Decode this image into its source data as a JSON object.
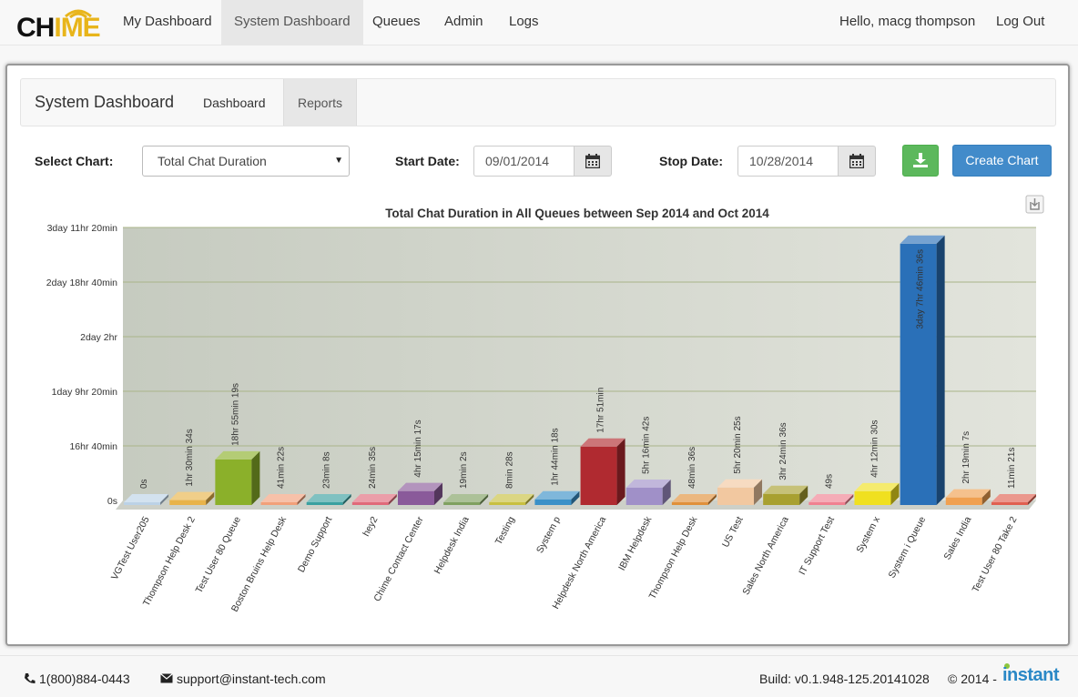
{
  "nav": {
    "logo_a": "CH",
    "logo_b": "ME",
    "logo_i": "I",
    "items": [
      {
        "label": "My Dashboard"
      },
      {
        "label": "System Dashboard"
      },
      {
        "label": "Queues"
      },
      {
        "label": "Admin"
      },
      {
        "label": "Logs"
      }
    ],
    "active": "System Dashboard",
    "user_greeting": "Hello, macg thompson",
    "logout": "Log Out"
  },
  "subnav": {
    "brand": "System Dashboard",
    "tabs": [
      {
        "label": "Dashboard"
      },
      {
        "label": "Reports"
      }
    ],
    "active": "Reports"
  },
  "form": {
    "select_label": "Select Chart:",
    "select_value": "Total Chat Duration",
    "start_label": "Start Date:",
    "start_value": "09/01/2014",
    "stop_label": "Stop Date:",
    "stop_value": "10/28/2014",
    "create_label": "Create Chart"
  },
  "chart_data": {
    "type": "bar",
    "title": "Total Chat Duration in All Queues between Sep 2014 and Oct 2014",
    "xlabel": "",
    "ylabel": "",
    "ylim": [
      0,
      300000
    ],
    "yticks": [
      {
        "value": 0,
        "label": "0s"
      },
      {
        "value": 60000,
        "label": "16hr 40min"
      },
      {
        "value": 120000,
        "label": "1day 9hr 20min"
      },
      {
        "value": 180000,
        "label": "2day 2hr"
      },
      {
        "value": 240000,
        "label": "2day 18hr 40min"
      },
      {
        "value": 300000,
        "label": "3day 11hr 20min"
      }
    ],
    "grid": true,
    "categories": [
      "VGTest User205",
      "Thompson Help Desk 2",
      "Test User 80 Queue",
      "Boston Bruins Help Desk",
      "Demo Support",
      "hey2",
      "Chime Contact Center",
      "Helpdesk India",
      "Testing",
      "System p",
      "Helpdesk North America",
      "IBM Helpdesk",
      "Thompson Help Desk",
      "US Test",
      "Sales North America",
      "IT Support Test",
      "System x",
      "System i Queue",
      "Sales India",
      "Test User 80 Take 2"
    ],
    "values": [
      0,
      5434,
      50119,
      2482,
      1388,
      1475,
      15317,
      1142,
      508,
      6258,
      64260,
      19002,
      2916,
      19225,
      12276,
      49,
      15150,
      287196,
      8347,
      681
    ],
    "data_labels": [
      "0s",
      "1hr 30min 34s",
      "18hr 55min 19s",
      "41min 22s",
      "23min 8s",
      "24min 35s",
      "4hr 15min 17s",
      "19min 2s",
      "8min 28s",
      "1hr 44min 18s",
      "17hr 51min",
      "5hr 16min 42s",
      "48min 36s",
      "5hr 20min 25s",
      "3hr 24min 36s",
      "49s",
      "4hr 12min 30s",
      "3day 7hr 46min 36s",
      "2hr 19min 7s",
      "11min 21s"
    ],
    "colors": [
      "#bcd2e6",
      "#e8b34a",
      "#8bb02a",
      "#f2a07a",
      "#3aa0a0",
      "#e06a7a",
      "#8a5a9a",
      "#7fa060",
      "#c8c040",
      "#3a90c8",
      "#b02a30",
      "#a090c8",
      "#e0903a",
      "#f2c8a0",
      "#a8a030",
      "#f08090",
      "#f0e020",
      "#2a70b8",
      "#f0a050",
      "#e06050"
    ]
  },
  "footer": {
    "phone": "1(800)884-0443",
    "email": "support@instant-tech.com",
    "build": "Build: v0.1.948-125.20141028",
    "copyright": "© 2014 -",
    "company": "instant"
  }
}
